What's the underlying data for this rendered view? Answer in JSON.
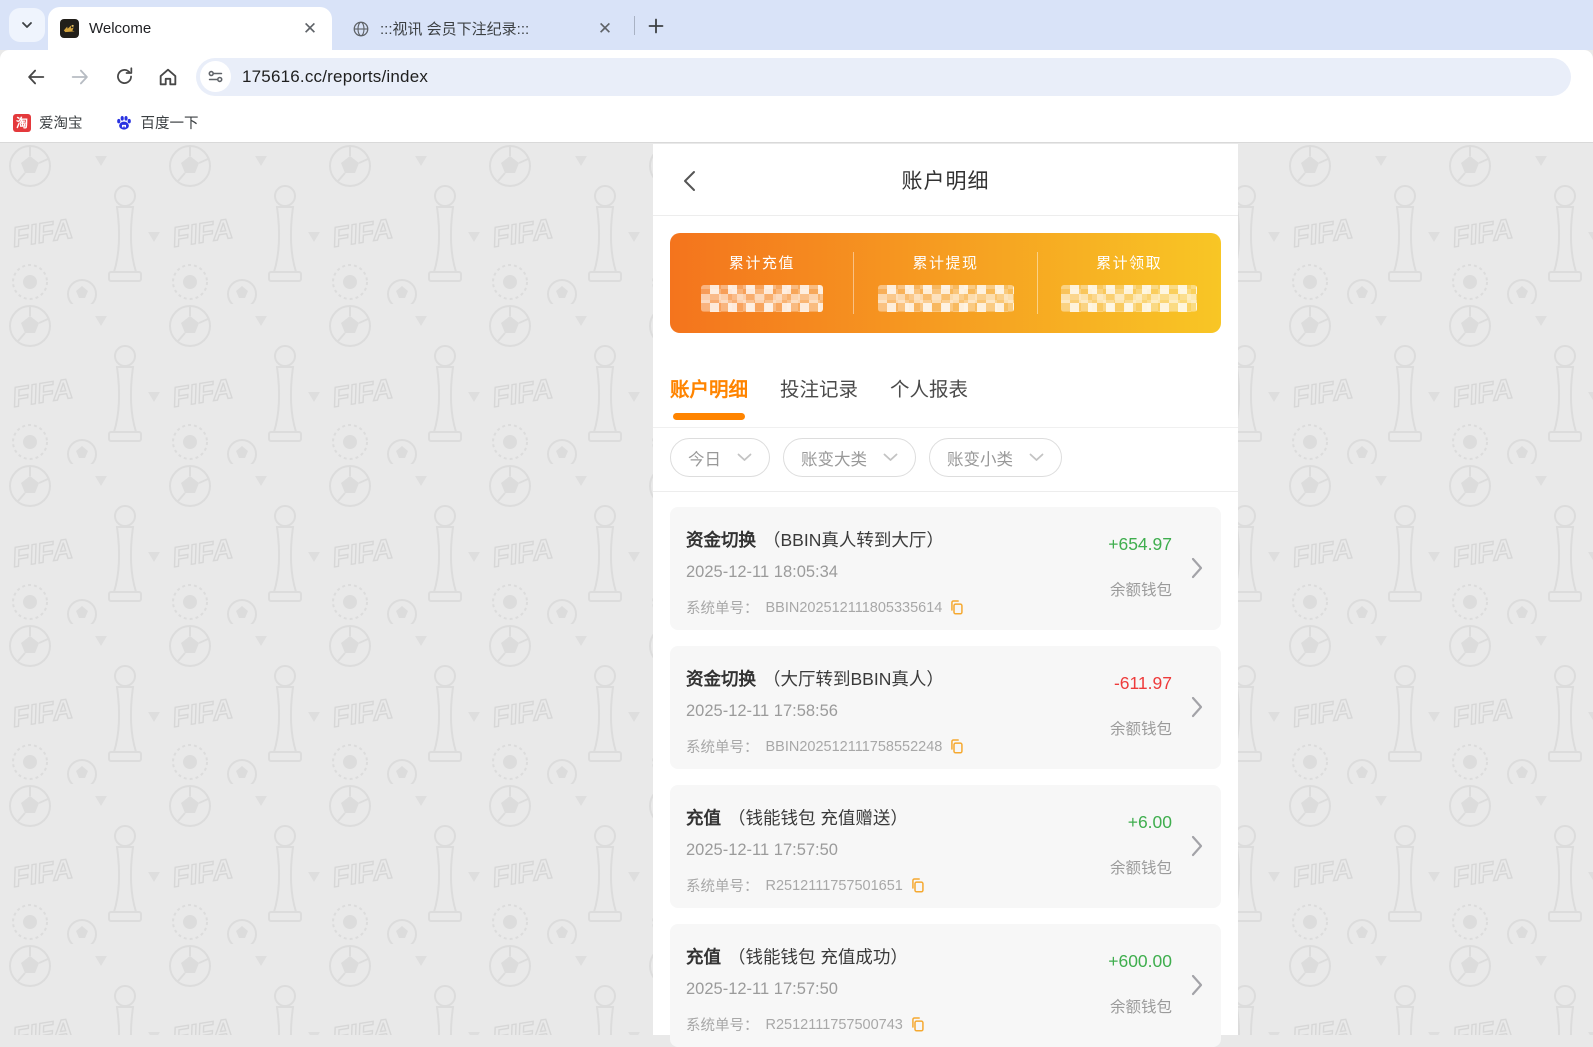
{
  "browser": {
    "tabs": [
      {
        "title": "Welcome",
        "active": true
      },
      {
        "title": ":::视讯 会员下注纪录:::",
        "active": false
      }
    ],
    "url": "175616.cc/reports/index",
    "bookmarks": [
      {
        "label": "爱淘宝",
        "icon": "taobao-icon",
        "icon_glyph": "淘"
      },
      {
        "label": "百度一下",
        "icon": "baidu-paw-icon"
      }
    ]
  },
  "page": {
    "title": "账户明细",
    "summary": [
      {
        "label": "累计充值",
        "value_masked": true
      },
      {
        "label": "累计提现",
        "value_masked": true
      },
      {
        "label": "累计领取",
        "value_masked": true
      }
    ],
    "nav_tabs": [
      {
        "label": "账户明细",
        "active": true
      },
      {
        "label": "投注记录",
        "active": false
      },
      {
        "label": "个人报表",
        "active": false
      }
    ],
    "filters": [
      {
        "label": "今日"
      },
      {
        "label": "账变大类"
      },
      {
        "label": "账变小类"
      }
    ],
    "order_label": "系统单号：",
    "records": [
      {
        "type": "资金切换",
        "subtitle": "（BBIN真人转到大厅）",
        "datetime": "2025-12-11 18:05:34",
        "order_no": "BBIN202512111805335614",
        "amount": "+654.97",
        "wallet": "余额钱包"
      },
      {
        "type": "资金切换",
        "subtitle": "（大厅转到BBIN真人）",
        "datetime": "2025-12-11 17:58:56",
        "order_no": "BBIN202512111758552248",
        "amount": "-611.97",
        "wallet": "余额钱包"
      },
      {
        "type": "充值",
        "subtitle": "（钱能钱包 充值赠送）",
        "datetime": "2025-12-11 17:57:50",
        "order_no": "R2512111757501651",
        "amount": "+6.00",
        "wallet": "余额钱包"
      },
      {
        "type": "充值",
        "subtitle": "（钱能钱包 充值成功）",
        "datetime": "2025-12-11 17:57:50",
        "order_no": "R2512111757500743",
        "amount": "+600.00",
        "wallet": "余额钱包"
      }
    ]
  },
  "colors": {
    "accent_orange": "#ff8400",
    "card_gradient_start": "#f4741d",
    "card_gradient_end": "#f8c625",
    "positive": "#3fae4e",
    "negative": "#ee3b3b",
    "copy_icon": "#f5a931",
    "tabstrip_bg": "#d9e3f8"
  }
}
